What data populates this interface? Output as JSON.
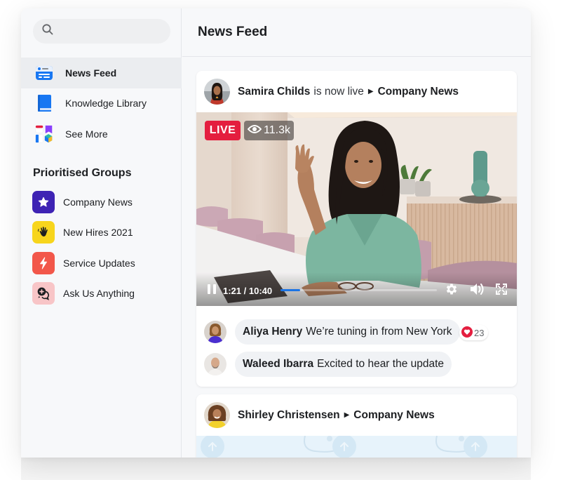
{
  "search": {
    "placeholder": "",
    "value": ""
  },
  "sidebar": {
    "nav": [
      {
        "label": "News Feed",
        "icon": "news-feed-icon",
        "active": true
      },
      {
        "label": "Knowledge Library",
        "icon": "book-icon",
        "active": false
      },
      {
        "label": "See More",
        "icon": "apps-grid-icon",
        "active": false
      }
    ],
    "groups_title": "Prioritised Groups",
    "groups": [
      {
        "label": "Company News",
        "icon": "star-icon",
        "color": "#3e23b4"
      },
      {
        "label": "New Hires 2021",
        "icon": "waving-hand-icon",
        "color": "#f7d51c"
      },
      {
        "label": "Service Updates",
        "icon": "lightning-icon",
        "color": "#f2574a"
      },
      {
        "label": "Ask Us Anything",
        "icon": "chat-question-icon",
        "color": "#f8c5c7"
      }
    ]
  },
  "main": {
    "title": "News Feed",
    "posts": [
      {
        "author": "Samira Childs",
        "verb": "is now live",
        "group": "Company News",
        "video": {
          "live_label": "LIVE",
          "views": "11.3k",
          "current_time": "1:21",
          "duration": "10:40",
          "time_display": "1:21 / 10:40",
          "progress": 0.127,
          "state": "playing"
        },
        "comments": [
          {
            "author": "Aliya Henry",
            "text": "We’re tuning in from New York",
            "reaction_count": "23"
          },
          {
            "author": "Waleed Ibarra",
            "text": "Excited to hear the update"
          }
        ]
      },
      {
        "author": "Shirley Christensen",
        "group": "Company News"
      }
    ]
  },
  "colors": {
    "live": "#e41e3f",
    "progress": "#1b74e4",
    "reaction": "#e41e3f"
  }
}
